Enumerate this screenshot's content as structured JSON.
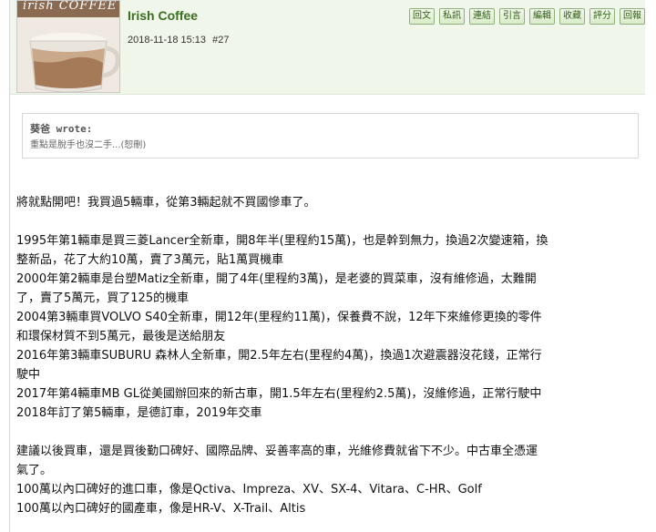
{
  "post": {
    "username": "Irish Coffee",
    "avatar_text": "irish COFFEE",
    "date": "2018-11-18 15:13",
    "post_number": "#27"
  },
  "toolbar": {
    "buttons": [
      "回文",
      "私訊",
      "連結",
      "引言",
      "編輯",
      "收藏",
      "評分",
      "回報"
    ]
  },
  "quote": {
    "author": "葵爸 wrote:",
    "text": "重點是脫手也沒二手...(恕刪)"
  },
  "body": {
    "intro": "將就點開吧！我買過5輛車，從第3輛起就不買國慘車了。",
    "lines": [
      "1995年第1輛車是買三菱Lancer全新車，開8年半(里程約15萬)，也是幹到無力，換過2次變速箱，換",
      "整新品，花了大約10萬，賣了3萬元，貼1萬買機車",
      "2000年第2輛車是台塑Matiz全新車，開了4年(里程約3萬)，是老婆的買菜車，沒有維修過，太難開",
      "了，賣了5萬元，買了125的機車",
      "2004第3輛車買VOLVO S40全新車，開12年(里程約11萬)，保養費不說，12年下來維修更換的零件",
      "和環保材質不到5萬元，最後是送給朋友",
      "2016年第3輛車SUBURU 森林人全新車，開2.5年左右(里程約4萬)，換過1次避震器沒花錢，正常行",
      "駛中",
      "2017年第4輛車MB GL從美國辦回來的新古車，開1.5年左右(里程約2.5萬)，沒維修過，正常行駛中",
      "2018年訂了第5輛車，是德訂車，2019年交車"
    ],
    "advice": [
      "建議以後買車，還是買後勤口碑好、國際品牌、妥善率高的車，光維修費就省下不少。中古車全憑運",
      "氣了。",
      "100萬以內口碑好的進口車，像是Qctiva、Impreza、XV、SX-4、Vitara、C-HR、Golf",
      "100萬以內口碑好的國產車，像是HR-V、X-Trail、Altis"
    ]
  },
  "colors": {
    "header_bg": "#f0f6e9",
    "username": "#3a6e22",
    "button_border": "#8fb07a"
  }
}
